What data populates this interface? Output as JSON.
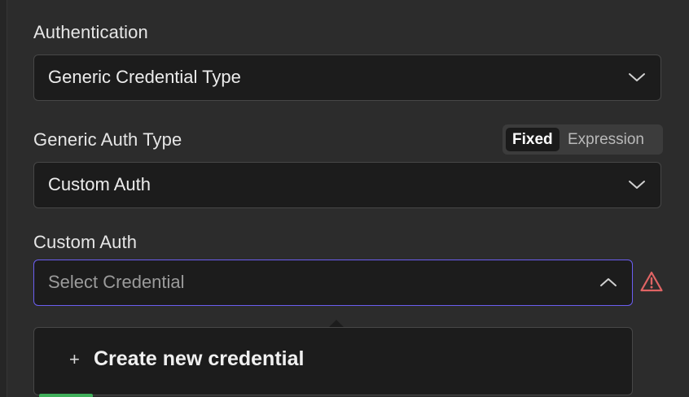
{
  "authentication": {
    "label": "Authentication",
    "value": "Generic Credential Type"
  },
  "generic_auth_type": {
    "label": "Generic Auth Type",
    "value": "Custom Auth",
    "mode_toggle": {
      "fixed_label": "Fixed",
      "expression_label": "Expression",
      "selected": "Fixed"
    }
  },
  "custom_auth": {
    "label": "Custom Auth",
    "placeholder": "Select Credential",
    "warning_icon": "warning-triangle-icon",
    "dropdown": {
      "items": [
        {
          "icon": "plus-icon",
          "plus_glyph": "+",
          "label": "Create new credential"
        }
      ]
    }
  },
  "colors": {
    "background": "#2c2c2c",
    "input_bg": "#1c1c1c",
    "focus_border": "#6b5ef0",
    "warning": "#e06464"
  }
}
